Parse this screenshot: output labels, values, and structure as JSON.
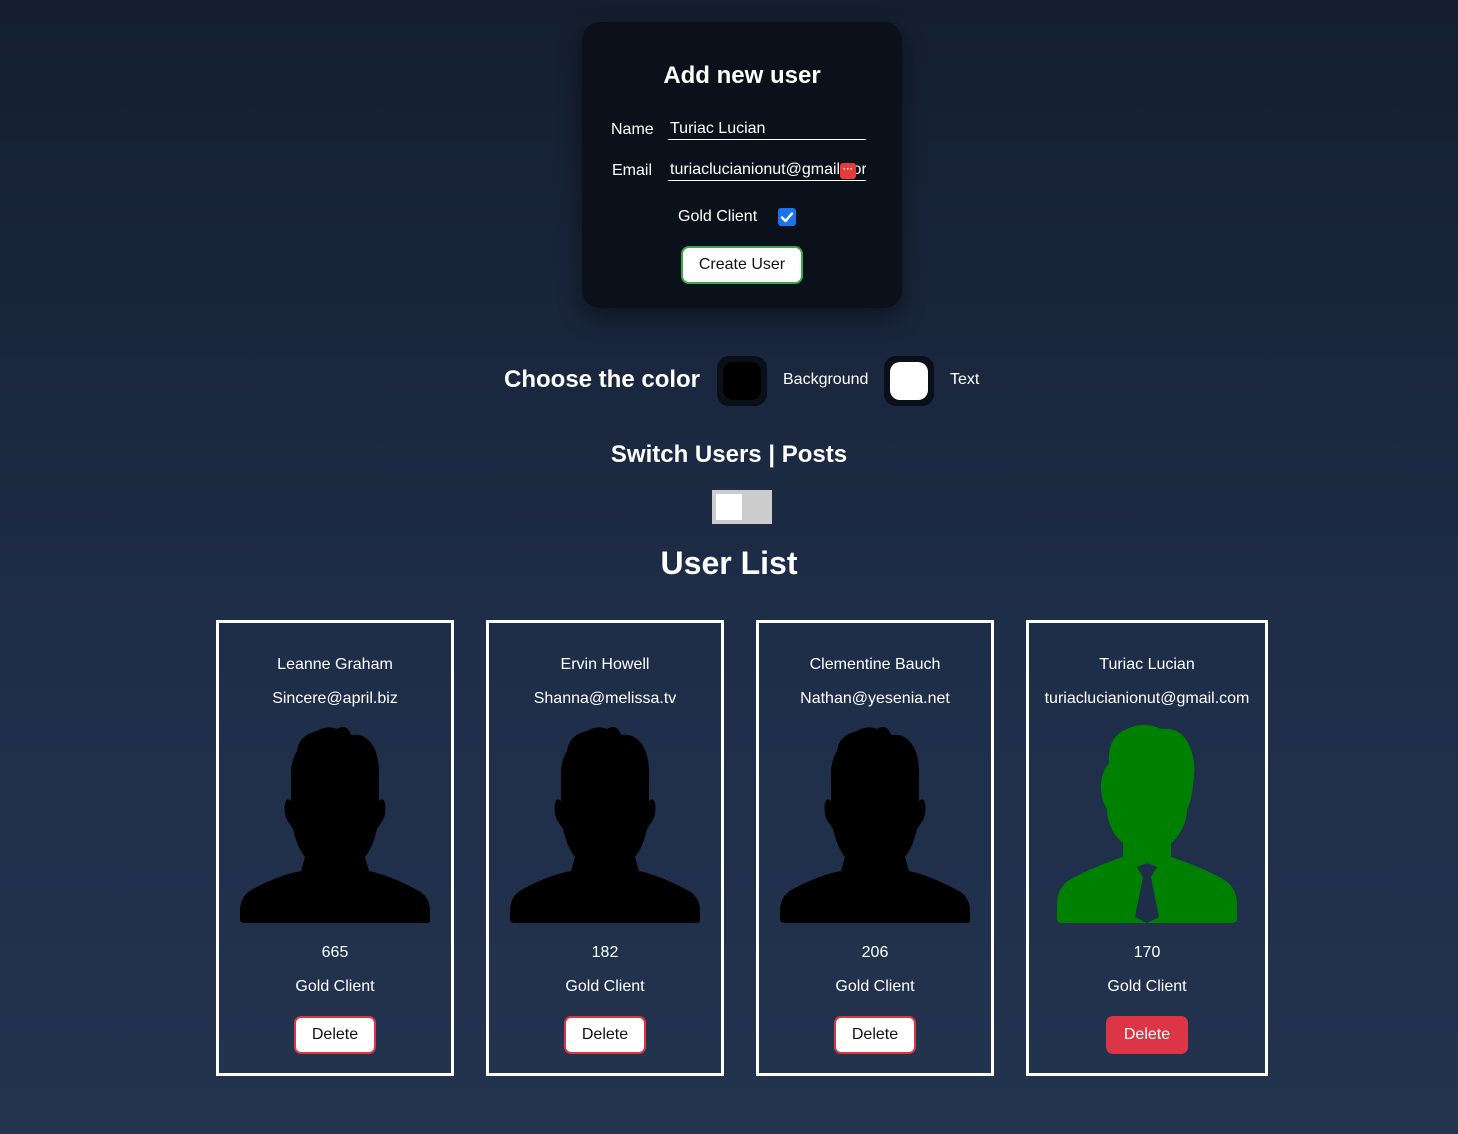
{
  "form": {
    "title": "Add new user",
    "name_label": "Name",
    "name_value": "Turiac Lucian",
    "email_label": "Email",
    "email_value": "turiaclucianionut@gmail.cor",
    "gold_label": "Gold Client",
    "gold_checked": true,
    "create_label": "Create User"
  },
  "colors": {
    "title": "Choose the color",
    "background_label": "Background",
    "background_value": "#000000",
    "text_label": "Text",
    "text_value": "#ffffff"
  },
  "switch": {
    "title": "Switch Users | Posts",
    "checked": false
  },
  "user_list": {
    "title": "User List",
    "users": [
      {
        "name": "Leanne Graham",
        "email": "Sincere@april.biz",
        "number": "665",
        "status": "Gold Client",
        "delete_label": "Delete",
        "avatar_icon": "male-silhouette-icon",
        "avatar_color": "#000000"
      },
      {
        "name": "Ervin Howell",
        "email": "Shanna@melissa.tv",
        "number": "182",
        "status": "Gold Client",
        "delete_label": "Delete",
        "avatar_icon": "male-silhouette-icon",
        "avatar_color": "#000000"
      },
      {
        "name": "Clementine Bauch",
        "email": "Nathan@yesenia.net",
        "number": "206",
        "status": "Gold Client",
        "delete_label": "Delete",
        "avatar_icon": "male-silhouette-icon",
        "avatar_color": "#000000"
      },
      {
        "name": "Turiac Lucian",
        "email": "turiaclucianionut@gmail.com",
        "number": "170",
        "status": "Gold Client",
        "delete_label": "Delete",
        "avatar_icon": "businessman-icon",
        "avatar_color": "#008000"
      }
    ]
  },
  "theme": {
    "card_border": "#ffffff",
    "delete_accent": "#dc3545",
    "create_accent": "#3ca64a",
    "checkbox_accent": "#1a73e8"
  }
}
